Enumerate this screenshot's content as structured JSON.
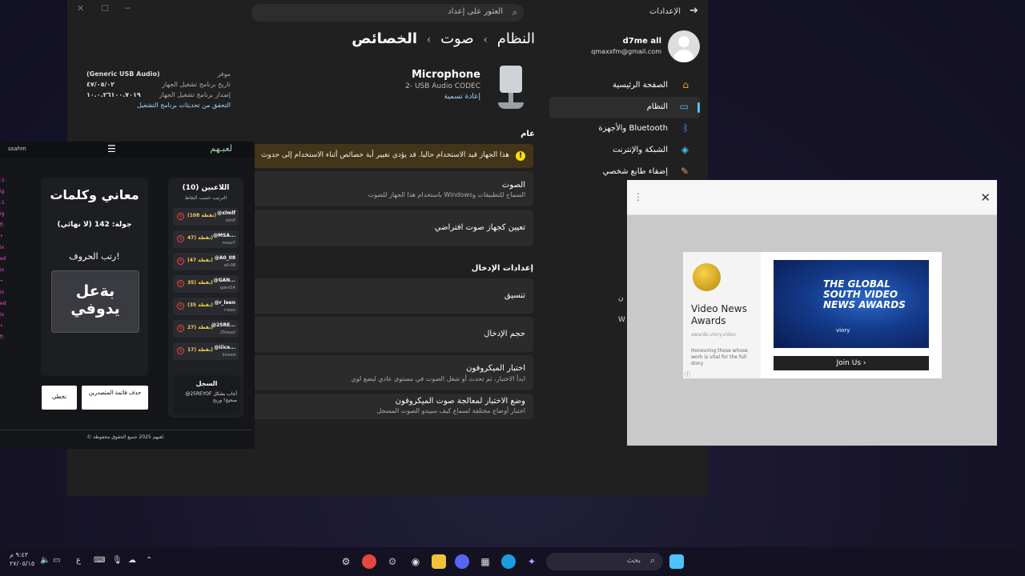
{
  "settings": {
    "title": "الإعدادات",
    "search_placeholder": "العثور على إعداد",
    "user": {
      "name": "d7me all",
      "email": "qmaxxfm@gmail.com"
    },
    "nav": [
      {
        "label": "الصفحة الرئيسية",
        "icon": "home-icon"
      },
      {
        "label": "النظام",
        "icon": "system-icon",
        "active": true
      },
      {
        "label": "Bluetooth والأجهزة",
        "icon": "bluetooth-icon"
      },
      {
        "label": "الشبكة والإنترنت",
        "icon": "wifi-icon"
      },
      {
        "label": "إضفاء طابع شخصي",
        "icon": "brush-icon"
      }
    ],
    "breadcrumb": [
      "النظام",
      "صوت",
      "الخصائص"
    ],
    "device": {
      "name": "Microphone",
      "sub": "2- USB Audio CODEC",
      "rename": "إعادة تسمية"
    },
    "driver": [
      {
        "key": "موفر",
        "value": "(Generic USB Audio)"
      },
      {
        "key": "تاريخ برنامج تشغيل الجهاز",
        "value": "٤٧/٠٥/٠٢"
      },
      {
        "key": "إصدار برنامج تشغيل الجهاز",
        "value": "١٠.٠.٢٦١٠٠.٧٠١٩"
      }
    ],
    "driver_link": "التحقق من تحديثات برنامج التشغيل",
    "general_title": "عام",
    "warning": "هذا الجهاز قيد الاستخدام حاليا. قد يؤدي تغيير أية خصائص أثناء الاستخدام إلى حدوث",
    "audio": {
      "title": "الصوت",
      "desc": "السماح للتطبيقات وWindows باستخدام هذا الجهاز للصوت"
    },
    "default_device": "تعيين كجهاز صوت افتراضي",
    "input_title": "إعدادات الإدخال",
    "format": "تنسيق",
    "input_volume": "حجم الإدخال",
    "mic_test": {
      "title": "اختبار الميكروفون",
      "desc": "ابدأ الاختبار، ثم تحدث أو شغل الصوت في مستوى عادي ليضع لوي"
    },
    "enhancement": {
      "title": "وضع الاختبار لمعالجة صوت الميكروفون",
      "desc": "اختبار أوضاع مختلفة لسماع كيف سيبدو الصوت المسجل"
    }
  },
  "ad": {
    "title": "Video News Awards",
    "url": "awards.viory.video",
    "description": "Honouring those whose work is vital for the full story",
    "image_text": "THE GLOBAL SOUTH VIDEO NEWS AWARDS",
    "brand": "viory",
    "cta": "Join Us"
  },
  "game": {
    "user": "ssahm",
    "logo": "لعبـهم",
    "title": "معاني وكلمات",
    "round": "جولة: 142 (لا نهائي)",
    "instruction": "رتب الحروف!",
    "scrambled": [
      "بةعل",
      "يدوفي"
    ],
    "skip": "تخطي",
    "delete_leaderboard": "حذف قائمة المتصدرين",
    "players_title": "اللاعبين (10)",
    "players_sub": "الترتيب حسب النقاط",
    "players": [
      {
        "name": "@xlmlf",
        "user": "xlmlf",
        "points": "(108 نقطة)"
      },
      {
        "name": "@MSA...",
        "user": "msaz7",
        "points": "47) نقطة)"
      },
      {
        "name": "@A0_08",
        "user": "a0-08",
        "points": "(47 نقطة)"
      },
      {
        "name": "@GAN...",
        "user": "gand14",
        "points": "35) نقطة)"
      },
      {
        "name": "@r_leen",
        "user": "r-leen",
        "points": "(35 نقطة)"
      },
      {
        "name": "@25RE...",
        "user": "25reyof",
        "points": "27) نقطة)"
      },
      {
        "name": "@iiice...",
        "user": "iiiceed",
        "points": "17) نقطة)"
      }
    ],
    "log_title": "السجل",
    "log_entry": "@25REYOF أجاب بشكل صحيح! وربح",
    "footer": "© لعبهم 2025 جميع الحقوق محفوظة."
  },
  "taskbar": {
    "search": "بحث",
    "time": "٩:٤٣ م",
    "date": "٢٧/٠٥/١٥",
    "lang": "ع"
  }
}
